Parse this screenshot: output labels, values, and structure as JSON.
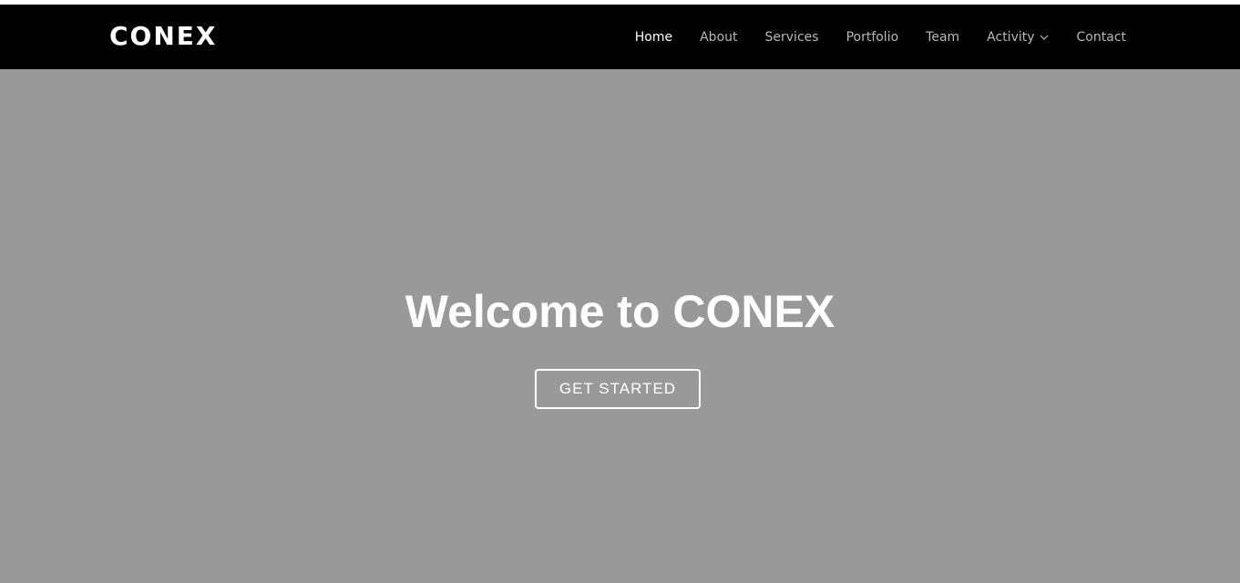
{
  "header": {
    "logo": "CONEX",
    "nav": [
      {
        "label": "Home",
        "active": true
      },
      {
        "label": "About"
      },
      {
        "label": "Services"
      },
      {
        "label": "Portfolio"
      },
      {
        "label": "Team"
      },
      {
        "label": "Activity",
        "has_dropdown": true,
        "icon": "chevron-down-icon"
      },
      {
        "label": "Contact"
      }
    ]
  },
  "hero": {
    "title": "Welcome to CONEX",
    "cta_label": "GET STARTED"
  },
  "colors": {
    "navbar_bg": "#000000",
    "hero_bg": "#999999",
    "text_active": "#ffffff",
    "text_muted": "#b9b9b9"
  }
}
